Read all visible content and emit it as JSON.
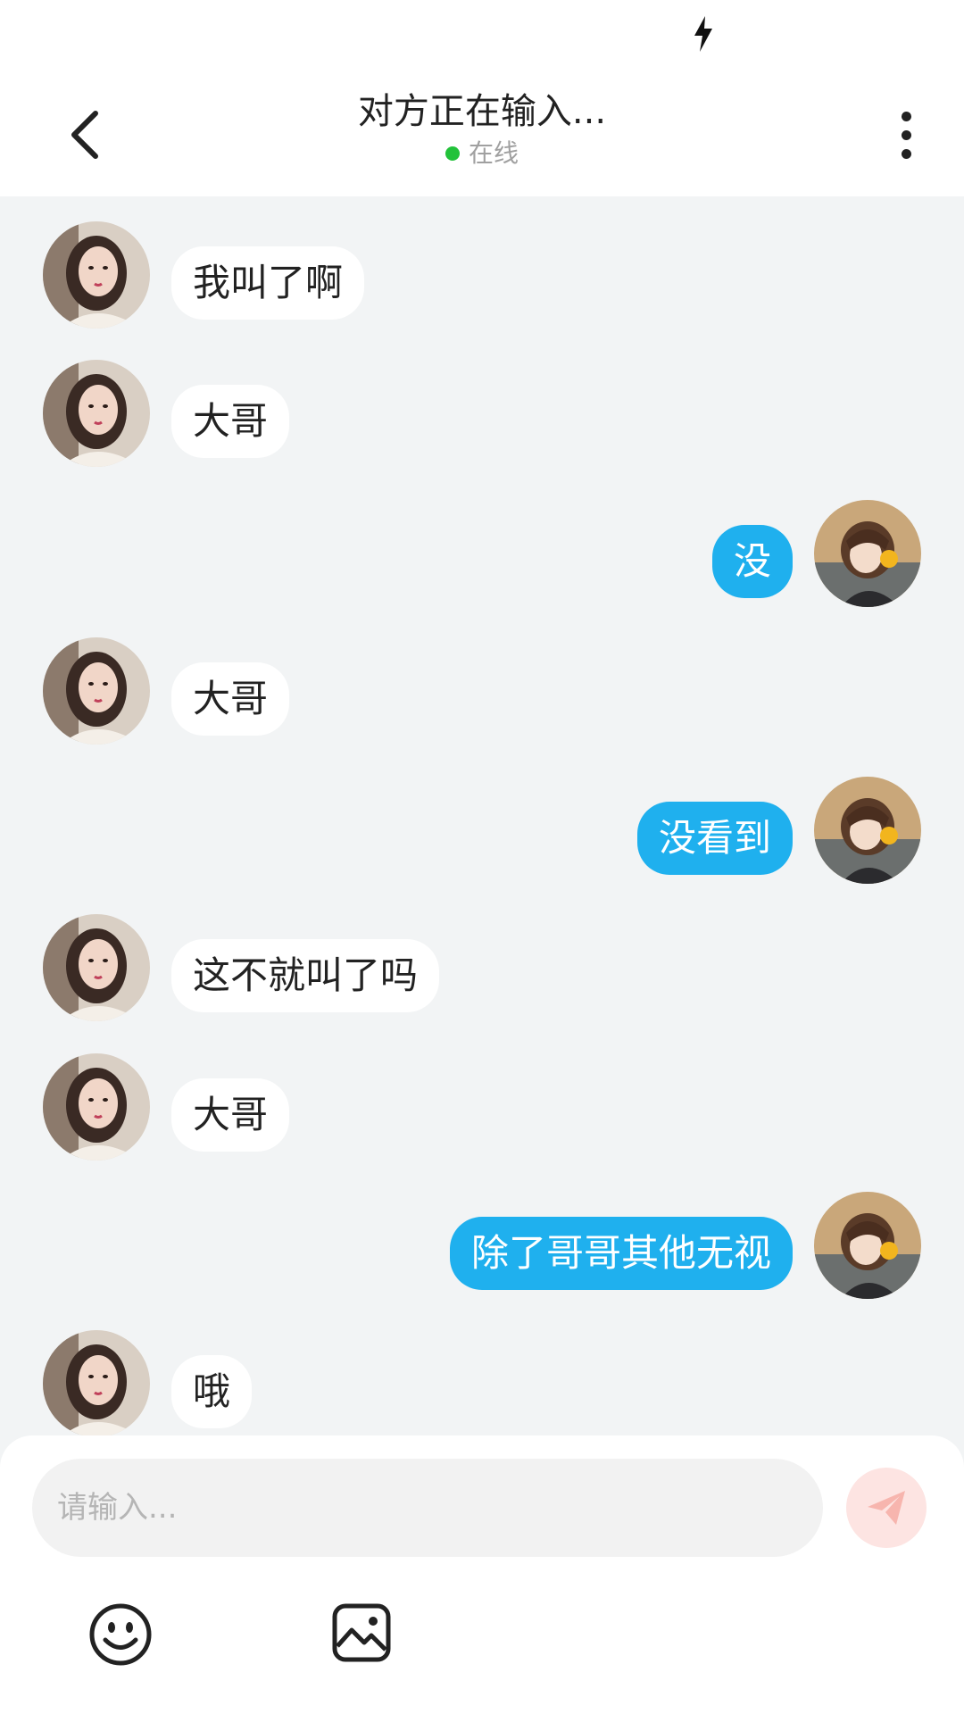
{
  "status_bar": {
    "icon": "lightning-icon"
  },
  "header": {
    "title": "对方正在输入...",
    "status": "在线",
    "status_color": "#22c23a",
    "back_icon": "chevron-left-icon",
    "more_icon": "more-vertical-icon"
  },
  "messages": [
    {
      "side": "in",
      "text": "我叫了啊"
    },
    {
      "side": "in",
      "text": "大哥"
    },
    {
      "side": "out",
      "text": "没"
    },
    {
      "side": "in",
      "text": "大哥"
    },
    {
      "side": "out",
      "text": "没看到"
    },
    {
      "side": "in",
      "text": "这不就叫了吗"
    },
    {
      "side": "in",
      "text": "大哥"
    },
    {
      "side": "out",
      "text": "除了哥哥其他无视"
    },
    {
      "side": "in",
      "text": "哦"
    }
  ],
  "composer": {
    "placeholder": "请输入...",
    "send_icon": "paper-plane-icon",
    "emoji_icon": "smiley-icon",
    "image_icon": "image-icon"
  },
  "colors": {
    "accent": "#1fb0ee",
    "background": "#f2f4f5",
    "send_button": "#fde4e2"
  }
}
